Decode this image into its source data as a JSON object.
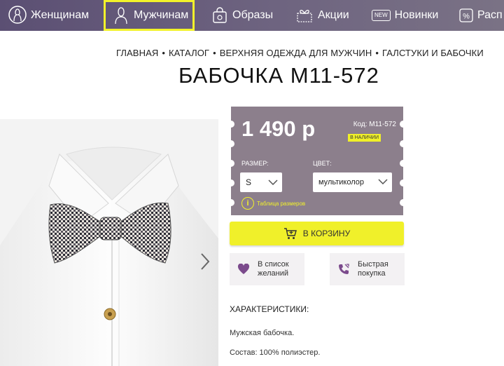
{
  "nav": {
    "items": [
      {
        "label": "Женщинам",
        "icon": "woman-icon"
      },
      {
        "label": "Мужчинам",
        "icon": "man-icon",
        "active": true
      },
      {
        "label": "Образы",
        "icon": "shopping-bag-icon"
      },
      {
        "label": "Акции",
        "icon": "gift-tag-icon"
      },
      {
        "label": "Новинки",
        "icon": "new-badge-icon",
        "badge": "NEW"
      },
      {
        "label": "Расп",
        "icon": "percent-icon"
      }
    ]
  },
  "breadcrumb": [
    "ГЛАВНАЯ",
    "КАТАЛОГ",
    "ВЕРХНЯЯ ОДЕЖДА ДЛЯ МУЖЧИН",
    "ГАЛСТУКИ И БАБОЧКИ"
  ],
  "breadcrumb_sep": "•",
  "product": {
    "title": "БАБОЧКА M11-572",
    "price": "1 490 р",
    "code": "Код: M11-572",
    "stock": "В НАЛИЧИИ",
    "size_label": "РАЗМЕР:",
    "size_value": "S",
    "color_label": "ЦВЕТ:",
    "color_value": "мультиколор",
    "size_table": "Таблица размеров",
    "size_table_glyph": "i",
    "cart_label": "В КОРЗИНУ",
    "wishlist_label_1": "В список",
    "wishlist_label_2": "желаний",
    "quick_label_1": "Быстрая",
    "quick_label_2": "покупка"
  },
  "characteristics": {
    "title": "ХАРАКТЕРИСТИКИ:",
    "lines": [
      "Мужская бабочка.",
      "Состав: 100% полиэстер."
    ]
  },
  "colors": {
    "nav_bg": "#5b4f73",
    "accent_yellow": "#f0f02a",
    "price_card": "#8c7f8c",
    "icon_purple": "#7b4a8c"
  }
}
